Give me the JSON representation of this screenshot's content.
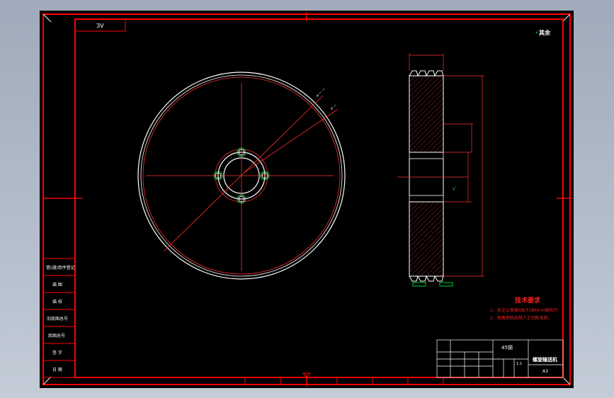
{
  "drawing": {
    "corner_code": "ЗV",
    "surface_symbol_text": "其余",
    "section_title": "技术要求",
    "notes": [
      "1、未注公差按GB/T1804-m级执行",
      "2、锐角倒钝去除人工切削毛刺。"
    ],
    "left_stamp_rows": [
      "借(通)用件登记",
      "描 图",
      "描 校",
      "旧底图总号",
      "底图总号",
      "签 字",
      "日 期"
    ],
    "title_block": {
      "material": "45钢",
      "part_name": "螺旋输送机",
      "sheet_size": "A3",
      "scale": "1:1"
    }
  },
  "colors": {
    "frame": "#ff0000",
    "outline": "#ffffff",
    "dim": "#ff3030",
    "hatch": "#c03030",
    "highlight": "#00ff40",
    "background": "#000000"
  }
}
